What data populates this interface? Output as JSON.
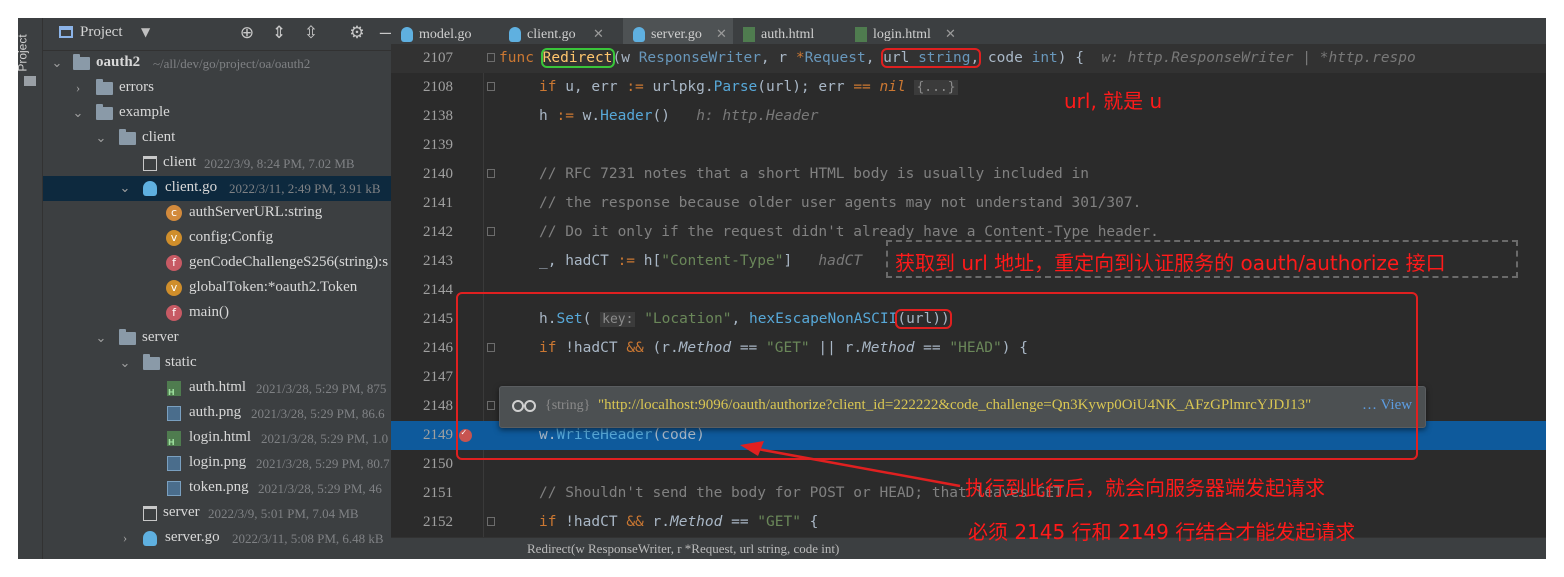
{
  "project_panel": {
    "title": "Project",
    "stripe_label": "Project",
    "tree": [
      {
        "label": "oauth2",
        "meta": "~/all/dev/go/project/oa/oauth2"
      },
      {
        "label": "errors",
        "meta": ""
      },
      {
        "label": "example",
        "meta": ""
      },
      {
        "label": "client",
        "meta": ""
      },
      {
        "label": "client",
        "meta": "2022/3/9, 8:24 PM, 7.02 MB"
      },
      {
        "label": "client.go",
        "meta": "2022/3/11, 2:49 PM, 3.91 kB"
      },
      {
        "label": "authServerURL:string",
        "meta": ""
      },
      {
        "label": "config:Config",
        "meta": ""
      },
      {
        "label": "genCodeChallengeS256(string):s",
        "meta": ""
      },
      {
        "label": "globalToken:*oauth2.Token",
        "meta": ""
      },
      {
        "label": "main()",
        "meta": ""
      },
      {
        "label": "server",
        "meta": ""
      },
      {
        "label": "static",
        "meta": ""
      },
      {
        "label": "auth.html",
        "meta": "2021/3/28, 5:29 PM, 875"
      },
      {
        "label": "auth.png",
        "meta": "2021/3/28, 5:29 PM, 86.6"
      },
      {
        "label": "login.html",
        "meta": "2021/3/28, 5:29 PM, 1.0"
      },
      {
        "label": "login.png",
        "meta": "2021/3/28, 5:29 PM, 80.7"
      },
      {
        "label": "token.png",
        "meta": "2021/3/28, 5:29 PM, 46"
      },
      {
        "label": "server",
        "meta": "2022/3/9, 5:01 PM, 7.04 MB"
      },
      {
        "label": "server.go",
        "meta": "2022/3/11, 5:08 PM, 6.48 kB"
      }
    ],
    "symbol_letters": {
      "const": "c",
      "var": "v",
      "func": "f"
    }
  },
  "tabs": [
    {
      "label": "model.go",
      "icon": "go-file-icon"
    },
    {
      "label": "client.go",
      "icon": "go-file-icon"
    },
    {
      "label": "server.go",
      "icon": "go-file-icon",
      "active": true
    },
    {
      "label": "auth.html",
      "icon": "html-file-icon"
    },
    {
      "label": "login.html",
      "icon": "html-file-icon"
    }
  ],
  "code": {
    "line_numbers": [
      "2107",
      "2108",
      "2138",
      "2139",
      "2140",
      "2141",
      "2142",
      "2143",
      "2144",
      "2145",
      "2146",
      "2147",
      "2148",
      "2149",
      "2150",
      "2151",
      "2152"
    ],
    "l2107": {
      "kw": "func",
      "name": "Redirect",
      "a1": "(w ",
      "t1": "ResponseWriter",
      "a2": ", r ",
      "star": "*",
      "t2": "Request",
      "a3": ", ",
      "urlp": "url ",
      "t3": "string",
      "comma": ",",
      "a4": " code ",
      "t4": "int",
      "a5": ") {",
      "hint": "w: http.ResponseWriter | *http.respo"
    },
    "l2108": {
      "kw": "if",
      "a1": " u, err ",
      "op": ":=",
      "a2": " urlpkg.",
      "fn": "Parse",
      "a3": "(url); err ",
      "op2": "==",
      "nil": "nil",
      "fold": "{...}"
    },
    "l2138": {
      "a1": "h ",
      "op": ":=",
      "a2": " w.",
      "fn": "Header",
      "a3": "()",
      "hint": "h: http.Header"
    },
    "l2140": "// RFC 7231 notes that a short HTML body is usually included in",
    "l2141": "// the response because older user agents may not understand 301/307.",
    "l2142": "// Do it only if the request didn't already have a Content-Type header.",
    "l2143": {
      "a1": "_, hadCT ",
      "op": ":=",
      "a2": " h[",
      "str": "\"Content-Type\"",
      "a3": "]",
      "hint": "hadCT"
    },
    "l2145": {
      "a1": "h.",
      "fn": "Set",
      "a2": "(",
      "hint": "key:",
      "str": "\"Location\"",
      "a3": ", ",
      "fn2": "hexEscapeNonASCII",
      "a4": "(",
      "arg": "url",
      "a5": "))"
    },
    "l2146": {
      "kw": "if",
      "a1": " !hadCT ",
      "op": "&&",
      "a2": " (r.",
      "it": "Method",
      "a3": " == ",
      "str": "\"GET\"",
      "a4": " || r.",
      "it2": "Method",
      "a5": " == ",
      "str2": "\"HEAD\"",
      "a6": ") {"
    },
    "l2148": "}",
    "l2149": {
      "a1": "w.",
      "fn": "WriteHeader",
      "a2": "(code)"
    },
    "l2151": "// Shouldn't send the body for POST or HEAD; that leaves GET.",
    "l2152": {
      "kw": "if",
      "a1": " !hadCT ",
      "op": "&&",
      "a2": " r.",
      "it": "Method",
      "a3": " == ",
      "str": "\"GET\"",
      "a4": " {"
    }
  },
  "tooltip": {
    "type": "{string}",
    "value": "\"http://localhost:9096/oauth/authorize?client_id=222222&code_challenge=Qn3Kywp0OiU4NK_AFzGPlmrcYJDJ13\"",
    "more": "…",
    "view": "View"
  },
  "annotations": {
    "url_note": "url, 就是 u",
    "get_url": "获取到 url 地址，重定向到认证服务的 oauth/authorize 接口",
    "after_exec": "执行到此行后，就会向服务器端发起请求",
    "must": "必须 2145 行和 2149 行结合才能发起请求",
    "color": "#ff1a1a"
  },
  "status": "Redirect(w ResponseWriter, r *Request, url string, code int)",
  "colors": {
    "keyword": "#cc7832",
    "string": "#6a8759",
    "comment": "#808080",
    "highlight": "#0e5a9c"
  }
}
